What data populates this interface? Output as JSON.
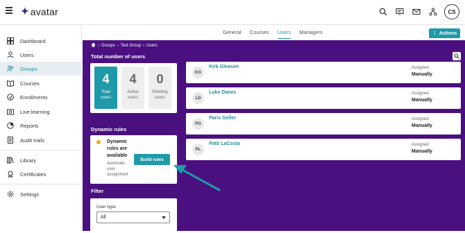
{
  "app": {
    "logo_mark": "✦",
    "logo_text": "avatar",
    "user_initials": "CS"
  },
  "top_icons": [
    "search-icon",
    "presentation-icon",
    "mail-icon",
    "hierarchy-icon"
  ],
  "sidebar": {
    "items": [
      {
        "label": "Dashboard",
        "icon": "dashboard-icon",
        "active": false
      },
      {
        "label": "Users",
        "icon": "user-icon",
        "active": false
      },
      {
        "label": "Groups",
        "icon": "groups-icon",
        "active": true
      },
      {
        "label": "Courses",
        "icon": "book-icon",
        "active": false
      },
      {
        "label": "Enrollments",
        "icon": "enroll-icon",
        "active": false
      },
      {
        "label": "Live learning",
        "icon": "camera-icon",
        "active": false
      },
      {
        "label": "Reports",
        "icon": "reports-icon",
        "active": false
      },
      {
        "label": "Audit trails",
        "icon": "audit-icon",
        "active": false
      },
      {
        "label": "Library",
        "icon": "library-icon",
        "active": false
      },
      {
        "label": "Certificates",
        "icon": "certificate-icon",
        "active": false
      },
      {
        "label": "Settings",
        "icon": "gear-icon",
        "active": false
      }
    ]
  },
  "tabs": [
    {
      "label": "General",
      "active": false
    },
    {
      "label": "Courses",
      "active": false
    },
    {
      "label": "Users",
      "active": true
    },
    {
      "label": "Managers",
      "active": false
    }
  ],
  "actions_label": "Actions",
  "breadcrumb": {
    "home_icon": "home-icon",
    "items": [
      "Groups",
      "Test Group",
      "Users"
    ]
  },
  "total_section": {
    "title": "Total number of users",
    "counts": [
      {
        "num": "4",
        "label_lines": [
          "Total",
          "users"
        ],
        "active": true
      },
      {
        "num": "4",
        "label_lines": [
          "Active",
          "users"
        ],
        "active": false
      },
      {
        "num": "0",
        "label_lines": [
          "Pending",
          "users"
        ],
        "active": false
      }
    ]
  },
  "dynamic_rules": {
    "title": "Dynamic rules",
    "status_title": "Dynamic rules are available",
    "status_sub": "Automate user assignment",
    "button": "Build rules"
  },
  "filter": {
    "title": "Filter",
    "user_type_label": "User type",
    "user_type_value": "All"
  },
  "users": [
    {
      "initials": "KG",
      "name": "Kirk Gleason",
      "meta_label": "Assigned",
      "meta_value": "Manually"
    },
    {
      "initials": "LD",
      "name": "Luke Danes",
      "meta_label": "Assigned",
      "meta_value": "Manually"
    },
    {
      "initials": "PG",
      "name": "Paris Geller",
      "meta_label": "Assigned",
      "meta_value": "Manually"
    },
    {
      "initials": "PL",
      "name": "Patti LaCosta",
      "meta_label": "Assigned",
      "meta_value": "Manually"
    }
  ],
  "colors": {
    "accent": "#1f9aa8",
    "main_bg": "#4a1080",
    "status_dot": "#f5a623"
  }
}
